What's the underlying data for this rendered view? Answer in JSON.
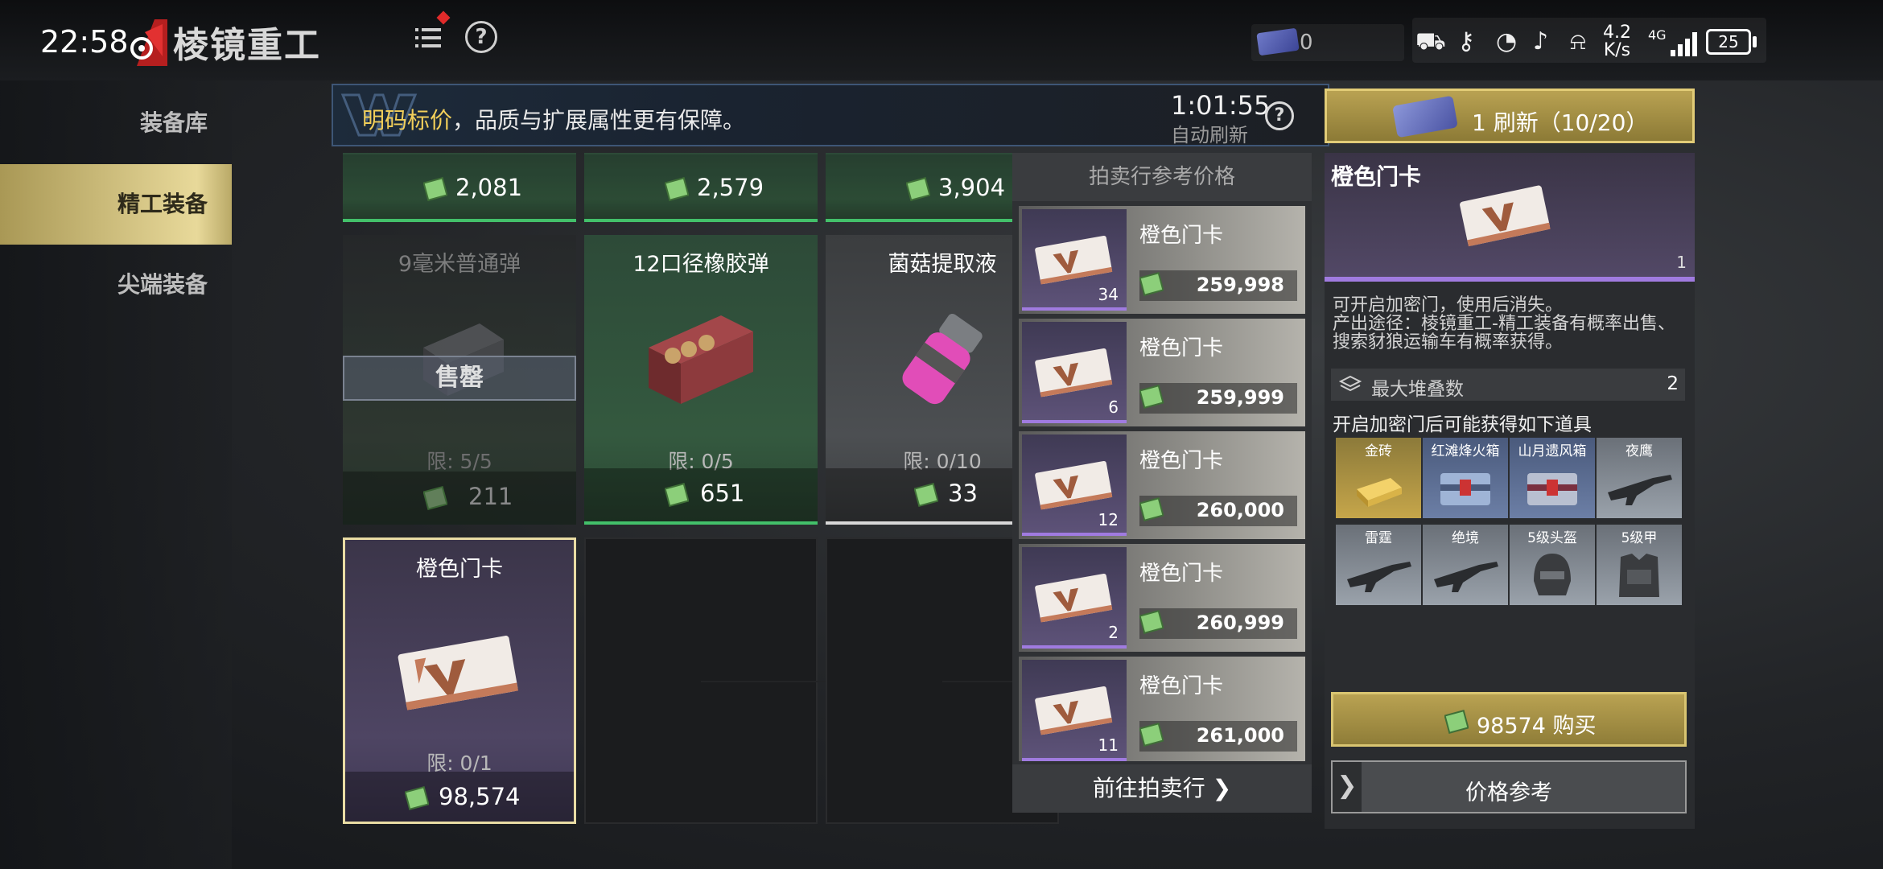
{
  "status_bar": {
    "time": "22:58",
    "net_speed_value": "4.2",
    "net_speed_unit": "K/s",
    "net_type": "4G",
    "battery": "25"
  },
  "header": {
    "title": "棱镜重工",
    "ticket_count": "0"
  },
  "sidebar": {
    "items": [
      {
        "label": "装备库"
      },
      {
        "label": "精工装备"
      },
      {
        "label": "尖端装备"
      }
    ],
    "active_index": 1
  },
  "banner": {
    "highlight": "明码标价",
    "text": "，品质与扩展属性更有保障。"
  },
  "timer": {
    "value": "1:01:55",
    "label": "自动刷新"
  },
  "refresh_button": {
    "label": "1 刷新（10/20）"
  },
  "shop_items": [
    {
      "name": "",
      "limit": "",
      "price": "2,081",
      "rarity": "green"
    },
    {
      "name": "",
      "limit": "",
      "price": "2,579",
      "rarity": "green"
    },
    {
      "name": "",
      "limit": "",
      "price": "3,904",
      "rarity": "green"
    },
    {
      "name": "9毫米普通弹",
      "limit": "限: 5/5",
      "price": "211",
      "rarity": "green",
      "status": "售罄"
    },
    {
      "name": "12口径橡胶弹",
      "limit": "限: 0/5",
      "price": "651",
      "rarity": "green"
    },
    {
      "name": "菌菇提取液",
      "limit": "限: 0/10",
      "price": "33",
      "rarity": "gray"
    },
    {
      "name": "橙色门卡",
      "limit": "限: 0/1",
      "price": "98,574",
      "rarity": "purple"
    }
  ],
  "auction": {
    "title": "拍卖行参考价格",
    "listings": [
      {
        "name": "橙色门卡",
        "qty": "34",
        "price": "259,998"
      },
      {
        "name": "橙色门卡",
        "qty": "6",
        "price": "259,999"
      },
      {
        "name": "橙色门卡",
        "qty": "12",
        "price": "260,000"
      },
      {
        "name": "橙色门卡",
        "qty": "2",
        "price": "260,999"
      },
      {
        "name": "橙色门卡",
        "qty": "11",
        "price": "261,000"
      }
    ],
    "go_label": "前往拍卖行"
  },
  "detail": {
    "name": "橙色门卡",
    "count": "1",
    "desc_line1": "可开启加密门，使用后消失。",
    "desc_line2": "产出途径：棱镜重工-精工装备有概率出售、搜索豺狼运输车有概率获得。",
    "stack_label": "最大堆叠数",
    "stack_value": "2",
    "loot_title": "开启加密门后可能获得如下道具",
    "loot": [
      {
        "name": "金砖",
        "tier": "gold"
      },
      {
        "name": "红滩烽火箱",
        "tier": "blue"
      },
      {
        "name": "山月遗风箱",
        "tier": "blue"
      },
      {
        "name": "夜鹰",
        "tier": "silver"
      },
      {
        "name": "雷霆",
        "tier": "silver"
      },
      {
        "name": "绝境",
        "tier": "silver"
      },
      {
        "name": "5级头盔",
        "tier": "silver"
      },
      {
        "name": "5级甲",
        "tier": "silver"
      }
    ],
    "buy_label": "98574 购买",
    "price_ref_label": "价格参考"
  },
  "colors": {
    "accent_gold": "#e2cc77",
    "rarity_green": "#43c06a",
    "rarity_purple": "#a07be0"
  }
}
